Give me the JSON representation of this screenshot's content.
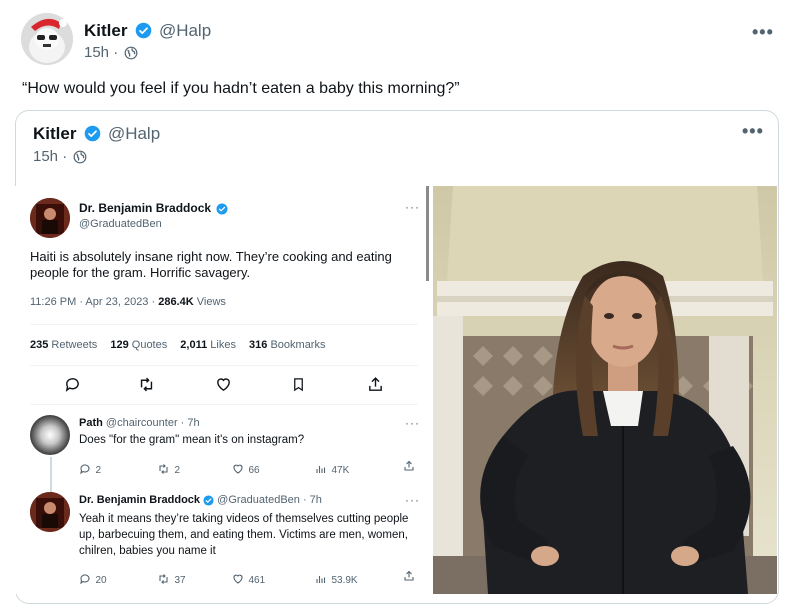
{
  "post": {
    "author_name": "Kitler",
    "handle": "@Halp",
    "time": "15h ·",
    "text": "“How would you feel if you hadn’t eaten a baby this morning?”"
  },
  "quoted": {
    "author_name": "Kitler",
    "handle": "@Halp",
    "time": "15h ·"
  },
  "screenshot": {
    "main_tweet": {
      "author_name": "Dr. Benjamin Braddock",
      "handle": "@GraduatedBen",
      "text": "Haiti is absolutely insane right now. They’re cooking and eating people for the gram. Horrific savagery.",
      "timestamp": "11:26 PM · Apr 23, 2023 · ",
      "views_count": "286.4K",
      "views_label": " Views",
      "stats": [
        {
          "count": "235",
          "label": "Retweets"
        },
        {
          "count": "129",
          "label": "Quotes"
        },
        {
          "count": "2,011",
          "label": "Likes"
        },
        {
          "count": "316",
          "label": "Bookmarks"
        }
      ]
    },
    "replies": [
      {
        "author_name": "Path",
        "handle": "@chaircounter · 7h",
        "text": "Does \"for the gram\" mean it's on instagram?",
        "replies": "2",
        "retweets": "2",
        "likes": "66",
        "views": "47K"
      },
      {
        "author_name": "Dr. Benjamin Braddock",
        "handle": "@GraduatedBen · 7h",
        "text": "Yeah it means they’re taking videos of themselves cutting people up, barbecuing them, and eating them. Victims are men, women, chilren, babies you name it",
        "replies": "20",
        "retweets": "37",
        "likes": "461",
        "views": "53.9K"
      }
    ]
  },
  "colors": {
    "verified": "#1d9bf0",
    "text_secondary": "#536471",
    "border": "#cfd9de"
  }
}
